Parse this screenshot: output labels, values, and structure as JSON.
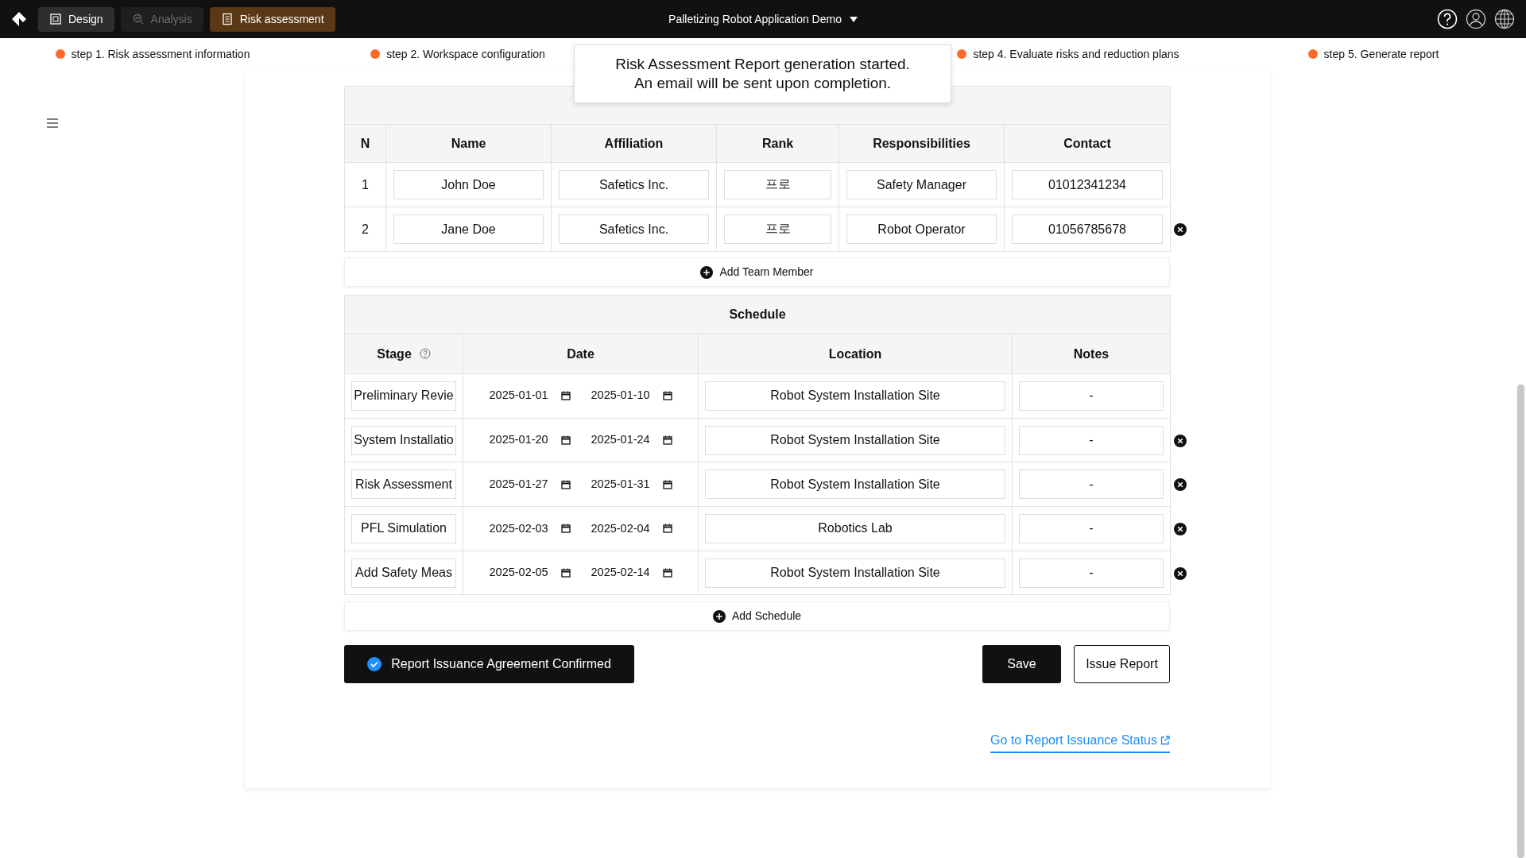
{
  "top_bar": {
    "tabs": [
      {
        "label": "Design",
        "selected": false,
        "disabled": false
      },
      {
        "label": "Analysis",
        "selected": false,
        "disabled": true
      },
      {
        "label": "Risk assessment",
        "selected": true,
        "disabled": false
      }
    ],
    "project": "Palletizing Robot Application Demo"
  },
  "steps": [
    {
      "label": "step 1. Risk assessment information"
    },
    {
      "label": "step 2. Workspace configuration"
    },
    {
      "label": "step 4. Evaluate risks and reduction plans"
    },
    {
      "label": "step 5. Generate report"
    }
  ],
  "toast": {
    "lines": [
      "Risk Assessment Report generation started.",
      "An email will be sent upon completion."
    ]
  },
  "team": {
    "columns": [
      "N",
      "Name",
      "Affiliation",
      "Rank",
      "Responsibilities",
      "Contact"
    ],
    "rows": [
      {
        "n": "1",
        "name": "John Doe",
        "affiliation": "Safetics Inc.",
        "rank": "프로",
        "responsibilities": "Safety Manager",
        "contact": "01012341234",
        "removable": false
      },
      {
        "n": "2",
        "name": "Jane Doe",
        "affiliation": "Safetics Inc.",
        "rank": "프로",
        "responsibilities": "Robot Operator",
        "contact": "01056785678",
        "removable": true
      }
    ],
    "add_label": "Add Team Member"
  },
  "schedule": {
    "title": "Schedule",
    "columns": [
      {
        "label": "Stage",
        "help": true
      },
      {
        "label": "Date",
        "help": false
      },
      {
        "label": "Location",
        "help": false
      },
      {
        "label": "Notes",
        "help": false
      }
    ],
    "rows": [
      {
        "stage": "Preliminary Revie",
        "start": "2025-01-01",
        "end": "2025-01-10",
        "location": "Robot System Installation Site",
        "notes": "-",
        "removable": false
      },
      {
        "stage": "System Installatio",
        "start": "2025-01-20",
        "end": "2025-01-24",
        "location": "Robot System Installation Site",
        "notes": "-",
        "removable": true
      },
      {
        "stage": "Risk Assessment",
        "start": "2025-01-27",
        "end": "2025-01-31",
        "location": "Robot System Installation Site",
        "notes": "-",
        "removable": true
      },
      {
        "stage": "PFL Simulation",
        "start": "2025-02-03",
        "end": "2025-02-04",
        "location": "Robotics Lab",
        "notes": "-",
        "removable": true
      },
      {
        "stage": "Add Safety Meas",
        "start": "2025-02-05",
        "end": "2025-02-14",
        "location": "Robot System Installation Site",
        "notes": "-",
        "removable": true
      }
    ],
    "add_label": "Add Schedule"
  },
  "agreement": {
    "label": "Report Issuance Agreement Confirmed",
    "confirmed": true
  },
  "buttons": {
    "save": "Save",
    "issue": "Issue Report"
  },
  "report_link": "Go to Report Issuance Status"
}
